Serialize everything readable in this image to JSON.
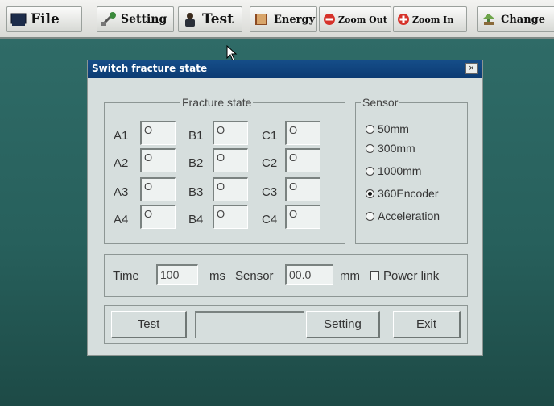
{
  "toolbar": {
    "file": "File",
    "setting": "Setting",
    "test": "Test",
    "energy": "Energy",
    "zoom_out": "Zoom Out",
    "zoom_in": "Zoom In",
    "change": "Change"
  },
  "dialog": {
    "title": "Switch fracture state",
    "close": "×",
    "fracture": {
      "legend": "Fracture state",
      "labels": [
        "A1",
        "B1",
        "C1",
        "A2",
        "B2",
        "C2",
        "A3",
        "B3",
        "C3",
        "A4",
        "B4",
        "C4"
      ],
      "values": [
        "O",
        "O",
        "O",
        "O",
        "O",
        "O",
        "O",
        "O",
        "O",
        "O",
        "O",
        "O"
      ]
    },
    "sensor": {
      "legend": "Sensor",
      "options": [
        "50mm",
        "300mm",
        "1000mm",
        "360Encoder",
        "Acceleration"
      ],
      "selected": "360Encoder"
    },
    "params": {
      "time_label": "Time",
      "time_value": "100",
      "time_unit": "ms",
      "sensor_label": "Sensor",
      "sensor_value": "00.0",
      "sensor_unit": "mm",
      "power_link_label": "Power link",
      "power_link_checked": false
    },
    "buttons": {
      "test": "Test",
      "setting": "Setting",
      "exit": "Exit"
    }
  }
}
